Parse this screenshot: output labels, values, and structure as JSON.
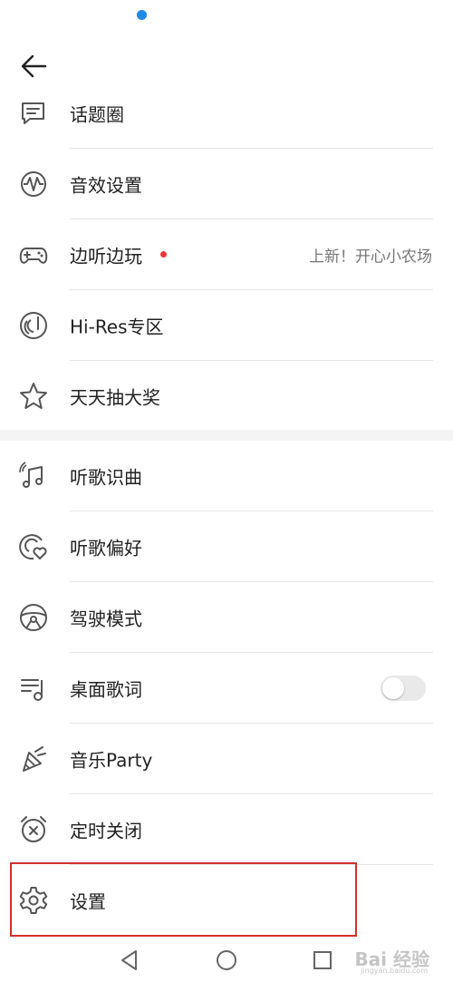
{
  "menu_top": [
    {
      "id": "topic",
      "label": "话题圈",
      "icon": "chat-icon"
    },
    {
      "id": "sound",
      "label": "音效设置",
      "icon": "sound-wave-icon"
    },
    {
      "id": "game",
      "label": "边听边玩",
      "icon": "gamepad-icon",
      "badge": "red-dot",
      "right_text": "上新！开心小农场"
    },
    {
      "id": "hires",
      "label": "Hi-Res专区",
      "icon": "hi-res-icon"
    },
    {
      "id": "lottery",
      "label": "天天抽大奖",
      "icon": "star-icon"
    }
  ],
  "menu_bottom": [
    {
      "id": "recognize",
      "label": "听歌识曲",
      "icon": "music-recognition-icon"
    },
    {
      "id": "preference",
      "label": "听歌偏好",
      "icon": "music-preference-icon"
    },
    {
      "id": "driving",
      "label": "驾驶模式",
      "icon": "steering-wheel-icon"
    },
    {
      "id": "lyrics",
      "label": "桌面歌词",
      "icon": "desktop-lyrics-icon",
      "toggle": false
    },
    {
      "id": "party",
      "label": "音乐Party",
      "icon": "party-hat-icon"
    },
    {
      "id": "timer",
      "label": "定时关闭",
      "icon": "alarm-clock-icon"
    },
    {
      "id": "settings",
      "label": "设置",
      "icon": "gear-icon"
    }
  ],
  "colors": {
    "accent_dot": "#e53935",
    "highlight": "#d32f2f",
    "status_icon": "#1e88e5"
  },
  "watermark": {
    "text": "Bai 经验",
    "sub": "jingyan.baidu.com"
  }
}
